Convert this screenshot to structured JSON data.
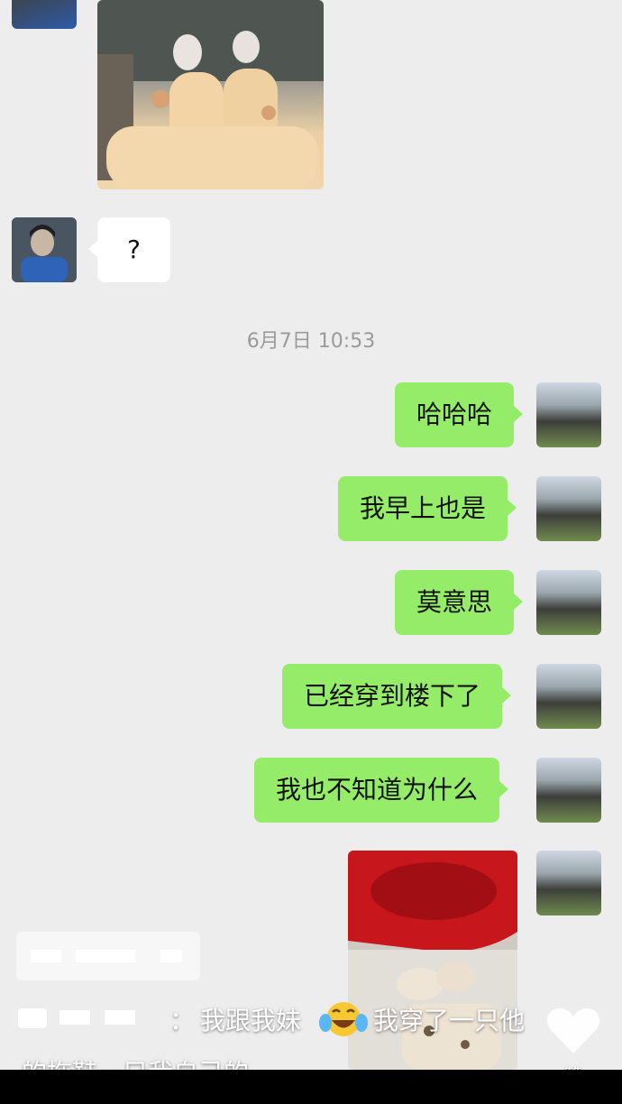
{
  "chat": {
    "timestamp": "6月7日 10:53",
    "left_message": "?",
    "right_messages": [
      "哈哈哈",
      "我早上也是",
      "莫意思",
      "已经穿到楼下了",
      "我也不知道为什么"
    ]
  },
  "caption": {
    "line1_a": "我跟我妹",
    "line1_b": "我穿了一只他",
    "line2": "的拖鞋一只我自己的",
    "separator": "："
  },
  "actions": {
    "like_label": "赞"
  },
  "colors": {
    "background": "#ededed",
    "sent_bubble": "#95ec69",
    "received_bubble": "#ffffff"
  }
}
